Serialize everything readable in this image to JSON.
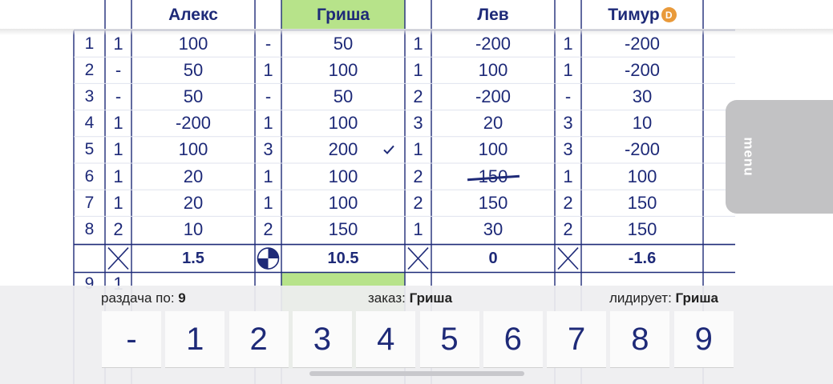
{
  "players": [
    {
      "name": "Алекс",
      "highlight": false,
      "dealer": false
    },
    {
      "name": "Гриша",
      "highlight": true,
      "dealer": false
    },
    {
      "name": "Лев",
      "highlight": false,
      "dealer": false
    },
    {
      "name": "Тимур",
      "highlight": false,
      "dealer": true,
      "dealer_badge": "D"
    }
  ],
  "rows": [
    {
      "num": "1",
      "bids": [
        "1",
        "-",
        "1",
        "1"
      ],
      "scores": [
        "100",
        "50",
        "-200",
        "-200"
      ]
    },
    {
      "num": "2",
      "bids": [
        "-",
        "1",
        "1",
        "1"
      ],
      "scores": [
        "50",
        "100",
        "100",
        "-200"
      ]
    },
    {
      "num": "3",
      "bids": [
        "-",
        "-",
        "2",
        "-"
      ],
      "scores": [
        "50",
        "50",
        "-200",
        "30"
      ]
    },
    {
      "num": "4",
      "bids": [
        "1",
        "1",
        "3",
        "3"
      ],
      "scores": [
        "-200",
        "100",
        "20",
        "10"
      ]
    },
    {
      "num": "5",
      "bids": [
        "1",
        "3",
        "1",
        "3"
      ],
      "scores": [
        "100",
        "200",
        "100",
        "-200"
      ]
    },
    {
      "num": "6",
      "bids": [
        "1",
        "1",
        "2",
        "1"
      ],
      "scores": [
        "20",
        "100",
        "150",
        "100"
      ]
    },
    {
      "num": "7",
      "bids": [
        "1",
        "1",
        "2",
        "2"
      ],
      "scores": [
        "20",
        "100",
        "150",
        "150"
      ]
    },
    {
      "num": "8",
      "bids": [
        "2",
        "2",
        "1",
        "2"
      ],
      "scores": [
        "10",
        "150",
        "30",
        "150"
      ]
    }
  ],
  "marks": {
    "check_row": 5,
    "check_player": 1,
    "struck_row": 6,
    "struck_player": 2
  },
  "totals": [
    "1.5",
    "10.5",
    "0",
    "-1.6"
  ],
  "next_row": {
    "num": "9",
    "bid": "1"
  },
  "menu_label": "menu",
  "info": {
    "deal_label": "раздача по:",
    "deal_value": "9",
    "order_label": "заказ:",
    "order_value": "Гриша",
    "leader_label": "лидирует:",
    "leader_value": "Гриша"
  },
  "keys": [
    "-",
    "1",
    "2",
    "3",
    "4",
    "5",
    "6",
    "7",
    "8",
    "9"
  ],
  "colors": {
    "ink": "#1e2a78",
    "highlight": "#b7e38a",
    "menu": "#c2c2c4",
    "badge": "#e99a3a"
  }
}
